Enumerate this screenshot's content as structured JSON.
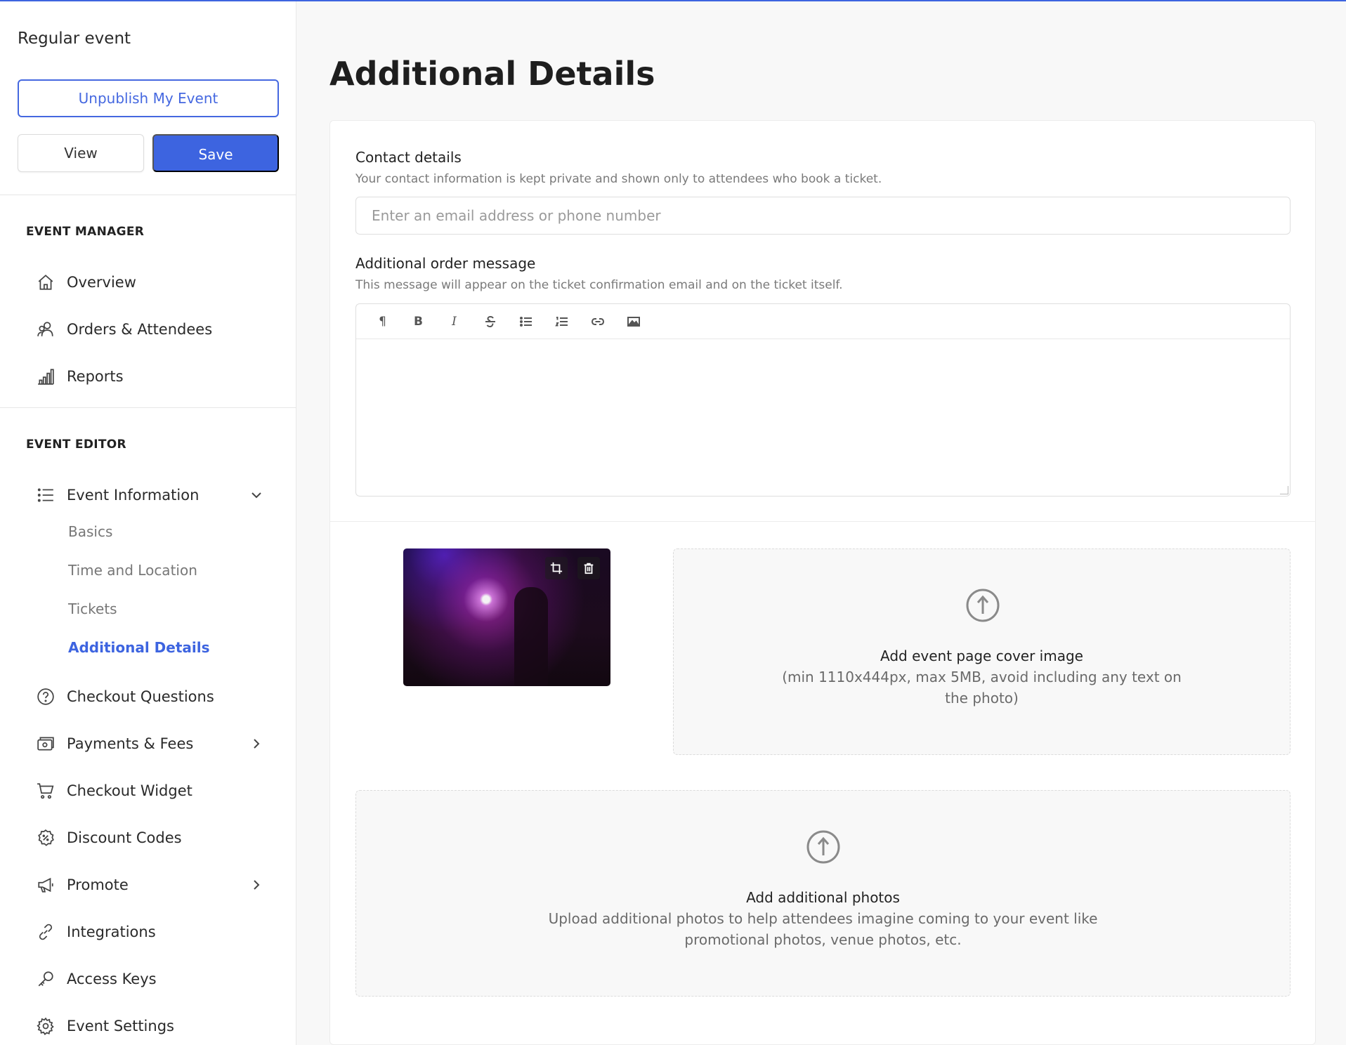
{
  "sidebar": {
    "event_name": "Regular event",
    "unpublish_label": "Unpublish My Event",
    "view_label": "View",
    "save_label": "Save",
    "event_manager": {
      "title": "EVENT MANAGER",
      "items": [
        {
          "label": "Overview",
          "icon": "home-icon"
        },
        {
          "label": "Orders & Attendees",
          "icon": "attendees-icon"
        },
        {
          "label": "Reports",
          "icon": "bar-chart-icon"
        }
      ]
    },
    "event_editor": {
      "title": "EVENT EDITOR",
      "event_information": "Event Information",
      "sub_items": [
        "Basics",
        "Time and Location",
        "Tickets",
        "Additional Details"
      ],
      "items": [
        {
          "label": "Checkout Questions",
          "icon": "question-circle-icon"
        },
        {
          "label": "Payments & Fees",
          "icon": "wallet-icon"
        },
        {
          "label": "Checkout Widget",
          "icon": "cart-icon"
        },
        {
          "label": "Discount Codes",
          "icon": "discount-badge-icon"
        },
        {
          "label": "Promote",
          "icon": "megaphone-icon"
        },
        {
          "label": "Integrations",
          "icon": "link-icon"
        },
        {
          "label": "Access Keys",
          "icon": "key-icon"
        },
        {
          "label": "Event Settings",
          "icon": "gear-icon"
        }
      ]
    }
  },
  "main": {
    "title": "Additional Details",
    "contact": {
      "label": "Contact details",
      "hint": "Your contact information is kept private and shown only to attendees who book a ticket.",
      "placeholder": "Enter an email address or phone number",
      "value": ""
    },
    "order_message": {
      "label": "Additional order message",
      "hint": "This message will appear on the ticket confirmation email and on the ticket itself.",
      "toolbar": {
        "paragraph": "¶",
        "bold": "B",
        "italic": "I"
      }
    },
    "cover_upload": {
      "title": "Add event page cover image",
      "subtitle": "(min 1110x444px, max 5MB, avoid including any text on the photo)"
    },
    "photos_upload": {
      "title": "Add additional photos",
      "subtitle": "Upload additional photos to help attendees imagine coming to your event like promotional photos, venue photos, etc."
    }
  },
  "colors": {
    "accent": "#3d64e0",
    "background": "#f8f8f8"
  }
}
